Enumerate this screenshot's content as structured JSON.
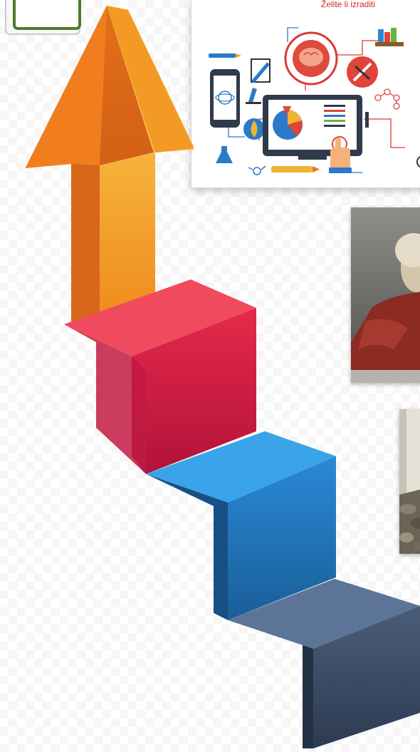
{
  "education_card": {
    "caption": "Želite li izraditi"
  },
  "colors": {
    "arrow_orange": "#f39a1f",
    "step_red": "#d7193f",
    "step_blue": "#1e7fcf",
    "step_slate": "#3b4e68",
    "caption_red": "#d7261e"
  }
}
